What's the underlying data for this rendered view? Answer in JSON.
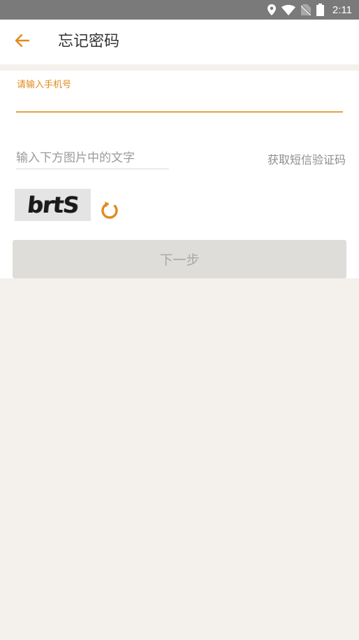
{
  "status_bar": {
    "time": "2:11",
    "icons": [
      "location-icon",
      "wifi-icon",
      "no-sim-icon",
      "battery-icon"
    ]
  },
  "header": {
    "title": "忘记密码",
    "back_icon": "arrow-left-icon"
  },
  "form": {
    "phone_label": "请输入手机号",
    "phone_value": "",
    "captcha_placeholder": "输入下方图片中的文字",
    "captcha_value": "",
    "sms_link": "获取短信验证码",
    "captcha_image_text": "brtS",
    "refresh_icon": "refresh-icon",
    "next_button": "下一步"
  },
  "colors": {
    "accent": "#e08a1e",
    "status_bar": "#7a7a7a",
    "background": "#f4f1ec",
    "button_disabled": "#deddd9"
  }
}
